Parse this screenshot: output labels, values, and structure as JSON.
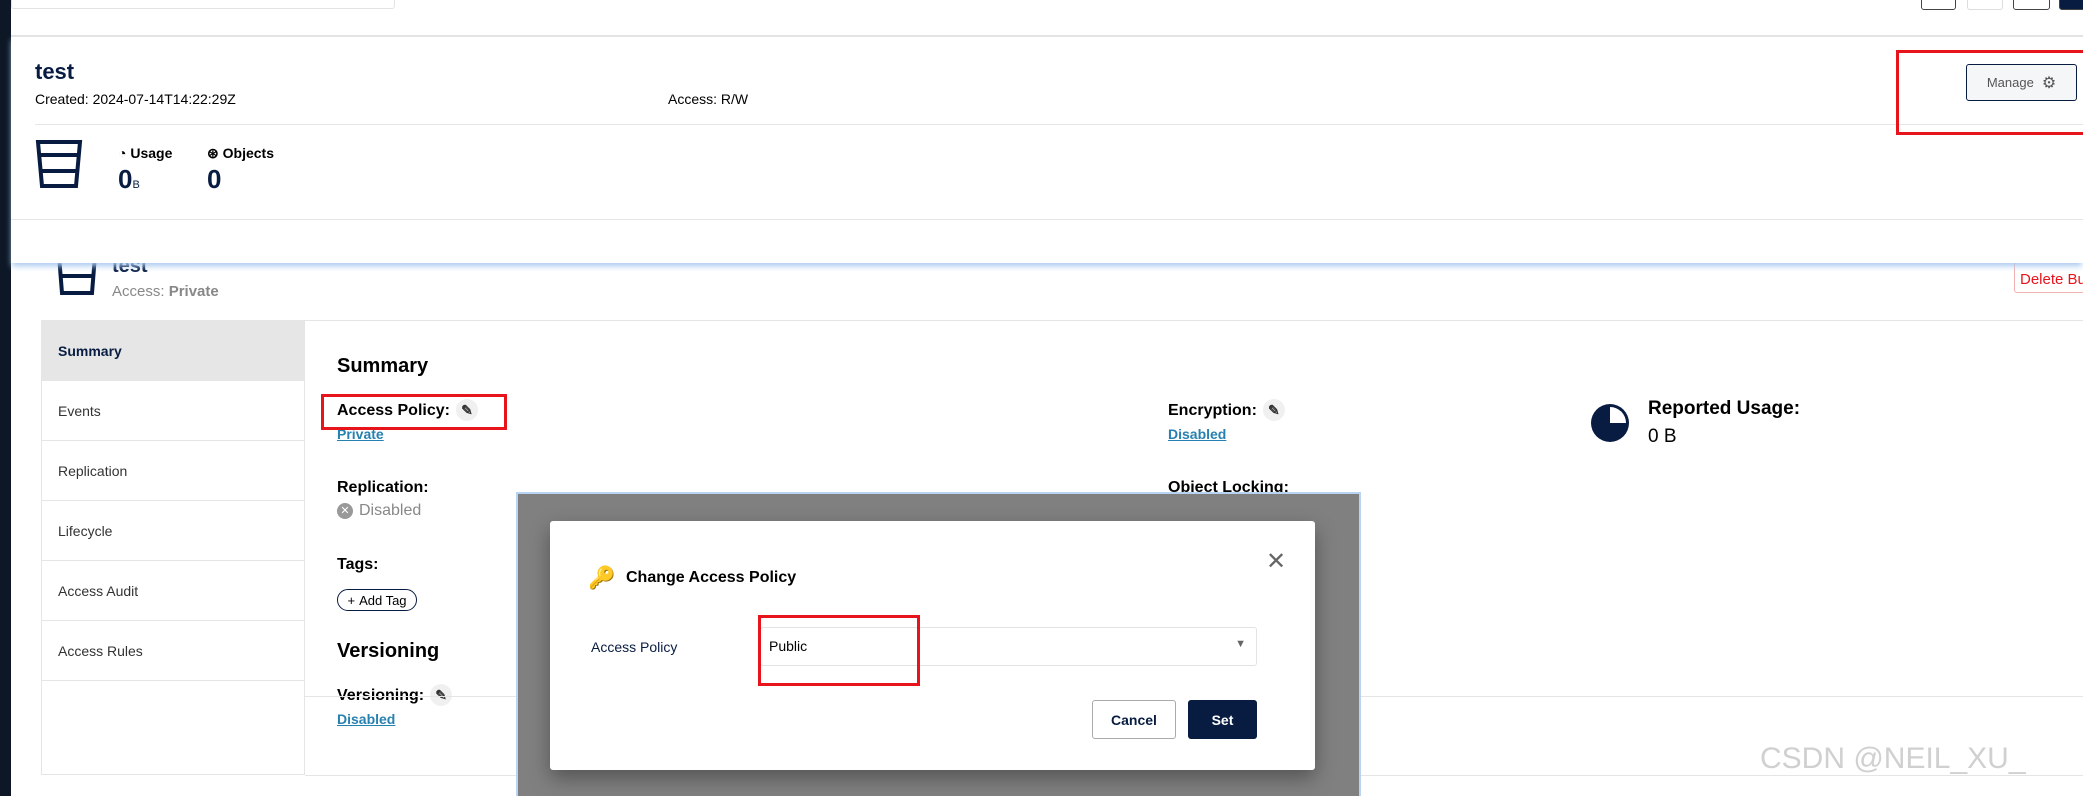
{
  "bucket_card": {
    "name": "test",
    "created": "Created: 2024-07-14T14:22:29Z",
    "access": "Access: R/W",
    "usage_label": "Usage",
    "usage_value": "0",
    "usage_unit": "B",
    "objects_label": "Objects",
    "objects_value": "0",
    "manage_label": "Manage"
  },
  "bucket_header": {
    "name": "test",
    "access_prefix": "Access:",
    "access_value": "Private",
    "delete_label": "Delete Bu"
  },
  "tabs": [
    {
      "label": "Summary",
      "selected": true
    },
    {
      "label": "Events"
    },
    {
      "label": "Replication"
    },
    {
      "label": "Lifecycle"
    },
    {
      "label": "Access Audit"
    },
    {
      "label": "Access Rules"
    }
  ],
  "summary": {
    "heading": "Summary",
    "access_policy_label": "Access Policy:",
    "access_policy_value": "Private",
    "replication_label": "Replication:",
    "replication_value": "Disabled",
    "tags_label": "Tags:",
    "add_tag_label": "Add Tag",
    "versioning_heading": "Versioning",
    "versioning_label": "Versioning:",
    "versioning_value": "Disabled",
    "encryption_label": "Encryption:",
    "encryption_value": "Disabled",
    "object_locking_label": "Object Locking:",
    "reported_usage_label": "Reported Usage:",
    "reported_usage_value": "0 B"
  },
  "dialog": {
    "title": "Change Access Policy",
    "field_label": "Access Policy",
    "selected_value": "Public",
    "cancel_label": "Cancel",
    "set_label": "Set"
  },
  "watermark": "CSDN @NEIL_XU_",
  "colors": {
    "primary": "#081c42",
    "link": "#2781b0",
    "danger": "#e8141c",
    "highlight": "#e8141c"
  }
}
